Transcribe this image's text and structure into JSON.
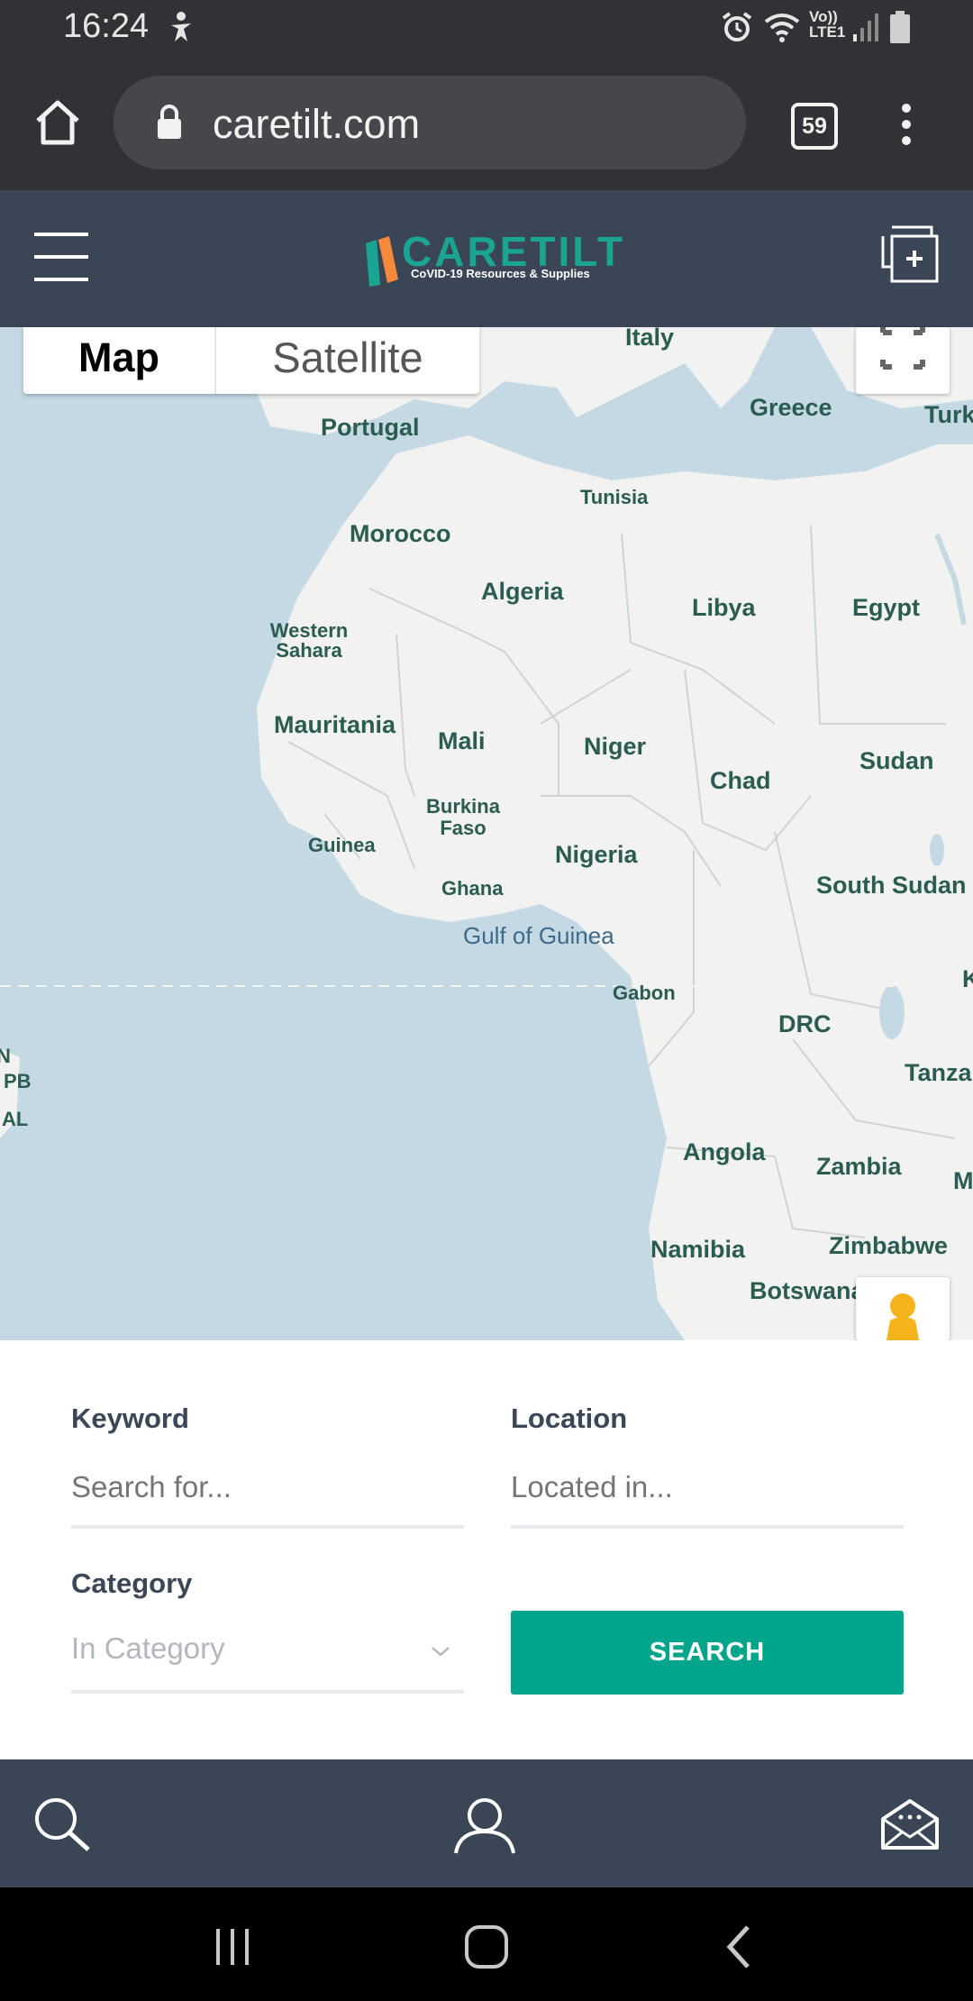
{
  "status_bar": {
    "time": "16:24",
    "network_label": "Vo)) LTE1"
  },
  "browser": {
    "url": "caretilt.com",
    "tab_count": "59"
  },
  "site": {
    "logo_text": "CARETILT",
    "logo_tagline": "CoVID-19 Resources & Supplies",
    "colors": {
      "header": "#3a4556",
      "accent": "#00a58b",
      "logo_orange": "#f58a3c",
      "logo_teal": "#1aa593"
    }
  },
  "map": {
    "tabs": {
      "map": "Map",
      "satellite": "Satellite"
    },
    "labels": {
      "italy": "Italy",
      "greece": "Greece",
      "turkey": "Turk",
      "portugal": "Portugal",
      "tunisia": "Tunisia",
      "morocco": "Morocco",
      "algeria": "Algeria",
      "libya": "Libya",
      "egypt": "Egypt",
      "western_sahara": "Western Sahara",
      "mauritania": "Mauritania",
      "mali": "Mali",
      "niger": "Niger",
      "chad": "Chad",
      "sudan": "Sudan",
      "burkina_faso": "Burkina Faso",
      "guinea": "Guinea",
      "nigeria": "Nigeria",
      "ghana": "Ghana",
      "south_sudan": "South Sudan",
      "gulf_of_guinea": "Gulf of Guinea",
      "gabon": "Gabon",
      "drc": "DRC",
      "tanzania": "Tanza",
      "angola": "Angola",
      "zambia": "Zambia",
      "namibia": "Namibia",
      "zimbabwe": "Zimbabwe",
      "botswana": "Botswana",
      "kenya": "K",
      "malawi": "M",
      "edge_n": "N",
      "edge_pb": "PB",
      "edge_al": "AL"
    }
  },
  "search_form": {
    "keyword": {
      "label": "Keyword",
      "placeholder": "Search for..."
    },
    "location": {
      "label": "Location",
      "placeholder": "Located in..."
    },
    "category": {
      "label": "Category",
      "selected": "In Category"
    },
    "search_button": "SEARCH"
  }
}
